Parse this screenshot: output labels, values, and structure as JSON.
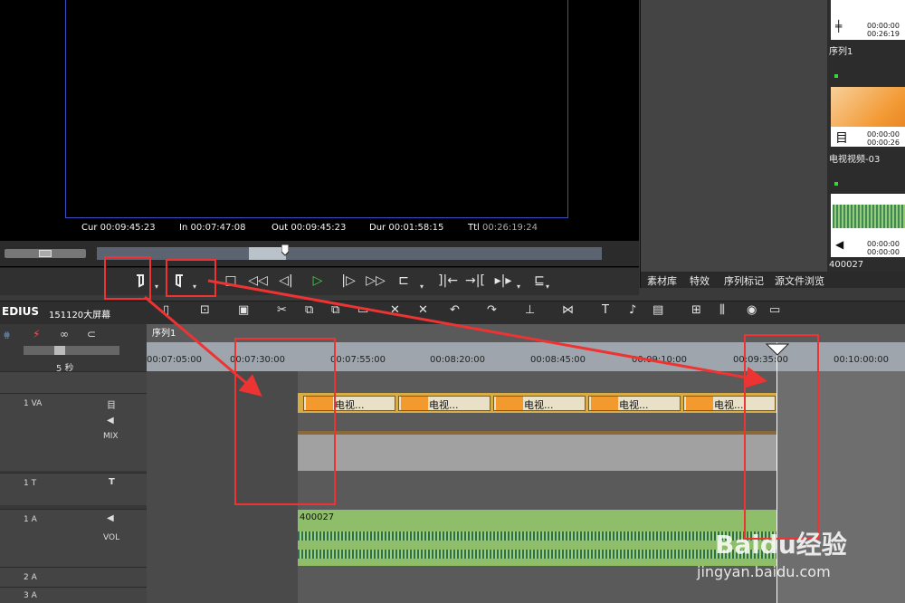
{
  "preview": {
    "timecodes": [
      {
        "label": "Cur",
        "value": "00:09:45:23"
      },
      {
        "label": "In",
        "value": "00:07:47:08"
      },
      {
        "label": "Out",
        "value": "00:09:45:23"
      },
      {
        "label": "Dur",
        "value": "00:01:58:15"
      },
      {
        "label": "Ttl",
        "value": "00:26:19:24"
      }
    ]
  },
  "transport": {
    "icons": [
      "mark-in-icon",
      "mark-out-icon",
      "stop-icon",
      "rewind-icon",
      "step-back-icon",
      "play-icon",
      "step-forward-icon",
      "fast-forward-icon",
      "loop-icon",
      "insert-icon",
      "overwrite-icon",
      "trim-icon",
      "export-icon"
    ]
  },
  "bin": {
    "items": [
      {
        "name": "序列1",
        "tc1": "00:00:00",
        "tc2": "00:26:19"
      },
      {
        "name": "电视视频-03",
        "tc1": "00:00:00",
        "tc2": "00:00:26"
      },
      {
        "name": "400027",
        "tc1": "00:00:00",
        "tc2": "00:00:00"
      }
    ],
    "tabs": [
      "素材库",
      "特效",
      "序列标记",
      "源文件浏览"
    ]
  },
  "toolbar": {
    "app": "EDIUS",
    "sequence": "151120大屏幕"
  },
  "timeline": {
    "sequence_tab": "序列1",
    "zoom": "5 秒",
    "ruler": [
      "00:07:05:00",
      "00:07:30:00",
      "00:07:55:00",
      "00:08:20:00",
      "00:08:45:00",
      "00:09:10:00",
      "00:09:35:00",
      "00:10:00:00"
    ],
    "tracks": [
      {
        "id": "1 VA",
        "mode": "MIX"
      },
      {
        "id": "1 T"
      },
      {
        "id": "1 A",
        "mode": "VOL"
      },
      {
        "id": "2 A"
      },
      {
        "id": "3 A"
      }
    ],
    "video_clip_label": "电视...",
    "audio_clip_label": "400027"
  },
  "watermark": {
    "brand": "Baidu经验",
    "url": "jingyan.baidu.com"
  },
  "colors": {
    "highlight": "#e33333",
    "audio_clip": "#8ebe6a",
    "video_clip": "#d8ad45"
  }
}
